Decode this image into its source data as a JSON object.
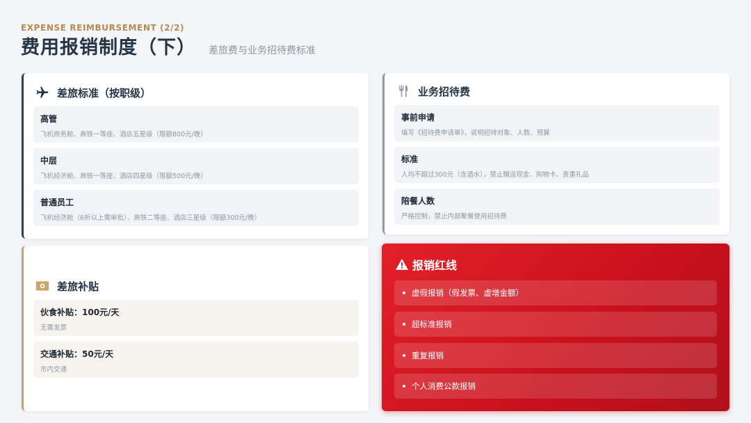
{
  "header": {
    "eyebrow": "EXPENSE REIMBURSEMENT (2/2)",
    "title": "费用报销制度（下）",
    "subtitle": "差旅费与业务招待费标准"
  },
  "travel_standard": {
    "title": "差旅标准（按职级）",
    "icon": "airplane-icon",
    "items": [
      {
        "title": "高管",
        "desc": "飞机商务舱、高铁一等座、酒店五星级（限额800元/晚）"
      },
      {
        "title": "中层",
        "desc": "飞机经济舱、高铁一等座、酒店四星级（限额500元/晚）"
      },
      {
        "title": "普通员工",
        "desc": "飞机经济舱（6折以上需审批）、高铁二等座、酒店三星级（限额300元/晚）"
      }
    ]
  },
  "entertainment": {
    "title": "业务招待费",
    "icon": "utensils-icon",
    "items": [
      {
        "title": "事前申请",
        "desc": "填写《招待费申请单》，说明招待对象、人数、预算"
      },
      {
        "title": "标准",
        "desc": "人均不超过300元（含酒水），禁止赠送现金、购物卡、贵重礼品"
      },
      {
        "title": "陪餐人数",
        "desc": "严格控制，禁止内部聚餐使用招待费"
      }
    ]
  },
  "allowance": {
    "title": "差旅补贴",
    "icon": "money-icon",
    "items": [
      {
        "title": "伙食补贴：100元/天",
        "desc": "无需发票"
      },
      {
        "title": "交通补贴：50元/天",
        "desc": "市内交通"
      }
    ]
  },
  "red_lines": {
    "title": "报销红线",
    "icon": "warning-icon",
    "items": [
      "虚假报销（假发票、虚增金额）",
      "超标准报销",
      "重复报销",
      "个人消费公款报销"
    ]
  },
  "colors": {
    "accent_gold": "#b58a55",
    "title_dark": "#253546",
    "red_start": "#e2202a",
    "red_end": "#b0101b"
  }
}
